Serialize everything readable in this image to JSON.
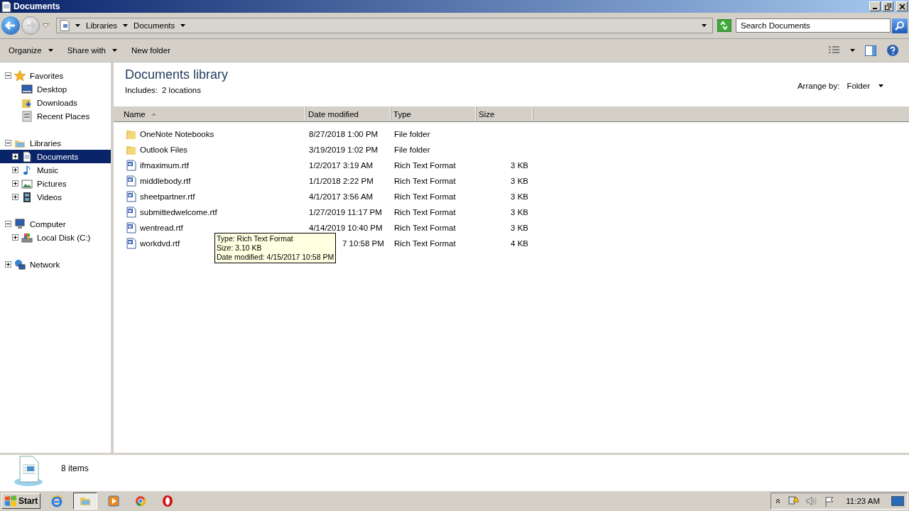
{
  "window": {
    "title": "Documents"
  },
  "address_bar": {
    "breadcrumbs": [
      "Libraries",
      "Documents"
    ],
    "search": {
      "placeholder": "Search Documents"
    }
  },
  "toolbar": {
    "buttons": [
      "Organize",
      "Share with",
      "New folder"
    ]
  },
  "sidebar": {
    "groups": [
      {
        "label": "Favorites",
        "kind": "star",
        "expanded": true,
        "selected": false,
        "children": [
          {
            "label": "Desktop",
            "kind": "desktop",
            "selected": false
          },
          {
            "label": "Downloads",
            "kind": "downloads",
            "selected": false
          },
          {
            "label": "Recent Places",
            "kind": "recent",
            "selected": false
          }
        ]
      },
      {
        "label": "Libraries",
        "kind": "library",
        "expanded": true,
        "selected": false,
        "children": [
          {
            "label": "Documents",
            "kind": "documents",
            "expanded": false,
            "selected": true
          },
          {
            "label": "Music",
            "kind": "music",
            "expanded": false,
            "selected": false
          },
          {
            "label": "Pictures",
            "kind": "pictures",
            "expanded": false,
            "selected": false
          },
          {
            "label": "Videos",
            "kind": "videos",
            "expanded": false,
            "selected": false
          }
        ]
      },
      {
        "label": "Computer",
        "kind": "computer",
        "expanded": true,
        "selected": false,
        "children": [
          {
            "label": "Local Disk (C:)",
            "kind": "disk",
            "expanded": false,
            "selected": false
          }
        ]
      },
      {
        "label": "Network",
        "kind": "network",
        "expanded": false,
        "selected": false
      }
    ]
  },
  "library": {
    "title": "Documents library",
    "includes_label": "Includes:",
    "includes_link": "2 locations",
    "arrange_label": "Arrange by:",
    "arrange_value": "Folder"
  },
  "table": {
    "columns": [
      "Name",
      "Date modified",
      "Type",
      "Size"
    ],
    "rows": [
      {
        "kind": "folder",
        "name": "OneNote Notebooks",
        "date": "8/27/2018 1:00 PM",
        "type": "File folder"
      },
      {
        "kind": "folder",
        "name": "Outlook Files",
        "date": "3/19/2019 1:02 PM",
        "type": "File folder"
      },
      {
        "kind": "document",
        "name": "ifmaximum.rtf",
        "date": "1/2/2017 3:19 AM",
        "type": "Rich Text Format",
        "size": "3 KB"
      },
      {
        "kind": "document",
        "name": "middlebody.rtf",
        "date": "1/1/2018 2:22 PM",
        "type": "Rich Text Format",
        "size": "3 KB"
      },
      {
        "kind": "document",
        "name": "sheetpartner.rtf",
        "date": "4/1/2017 3:56 AM",
        "type": "Rich Text Format",
        "size": "3 KB"
      },
      {
        "kind": "document",
        "name": "submittedwelcome.rtf",
        "date": "1/27/2019 11:17 PM",
        "type": "Rich Text Format",
        "size": "3 KB"
      },
      {
        "kind": "document",
        "name": "wentread.rtf",
        "date": "4/14/2019 10:40 PM",
        "type": "Rich Text Format",
        "size": "3 KB"
      },
      {
        "kind": "document",
        "name": "workdvd.rtf",
        "date": "7 10:58 PM",
        "type": "Rich Text Format",
        "size": "4 KB",
        "under_tooltip": true
      }
    ]
  },
  "tooltip": {
    "lines": [
      "Type: Rich Text Format",
      "Size: 3.10 KB",
      "Date modified: 4/15/2017 10:58 PM"
    ]
  },
  "details": {
    "count": "8 items"
  },
  "taskbar": {
    "start": "Start",
    "apps": [
      {
        "kind": "ie",
        "selected": false
      },
      {
        "kind": "explorer",
        "selected": true
      },
      {
        "kind": "media",
        "selected": false
      },
      {
        "kind": "chrome",
        "selected": false
      },
      {
        "kind": "opera",
        "selected": false
      }
    ],
    "clock": "11:23 AM"
  }
}
